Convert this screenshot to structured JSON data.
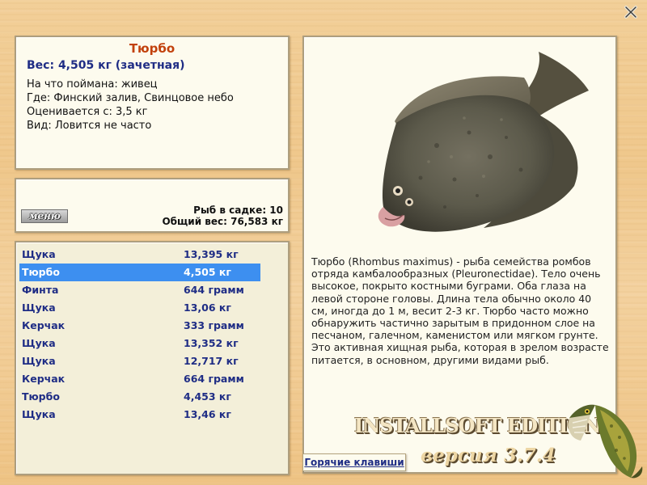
{
  "info": {
    "name": "Тюрбо",
    "weight_line": "Вес: 4,505 кг (зачетная)",
    "bait": "На что поймана: живец",
    "where": "Где: Финский залив, Свинцовое небо",
    "rated_from": "Оценивается с: 3,5 кг",
    "kind": "Вид: Ловится не часто"
  },
  "basket": {
    "menu_label": "меню",
    "fish_count": "Рыб в садке: 10",
    "total_weight": "Общий вес: 76,583 кг"
  },
  "catch_list": [
    {
      "name": "Щука",
      "weight": "13,395 кг"
    },
    {
      "name": "Тюрбо",
      "weight": "4,505 кг"
    },
    {
      "name": "Финта",
      "weight": "644 грамм"
    },
    {
      "name": "Щука",
      "weight": "13,06 кг"
    },
    {
      "name": "Керчак",
      "weight": "333 грамм"
    },
    {
      "name": "Щука",
      "weight": "13,352 кг"
    },
    {
      "name": "Щука",
      "weight": "12,717 кг"
    },
    {
      "name": "Керчак",
      "weight": "664 грамм"
    },
    {
      "name": "Тюрбо",
      "weight": "4,453 кг"
    },
    {
      "name": "Щука",
      "weight": "13,46 кг"
    }
  ],
  "selected_index": 1,
  "description": "Тюрбо (Rhombus maximus) - рыба семейства ромбов отряда камбалообразных (Pleuronectidae). Тело очень высокое, покрыто костными буграми. Оба глаза на левой стороне головы. Длина тела обычно около 40 см, иногда до 1 м, весит 2-3 кг. Тюрбо часто можно обнаружить частично зарытым в придонном слое на песчаном, галечном, каменистом или мягком грунте. Это активная хищная рыба, которая в зрелом возрасте питается, в основном, другими видами рыб.",
  "hotkeys_label": "Горячие клавиши",
  "edition": "INSTALLSOFT EDITION",
  "version": "версия 3.7.4",
  "close_icon": "close-x-icon",
  "colors": {
    "panel_bg": "#fdfbee",
    "list_bg": "#f3efd9",
    "name_accent": "#c2410c",
    "text_blue": "#1f2d85",
    "selection": "#3d8ff0"
  }
}
